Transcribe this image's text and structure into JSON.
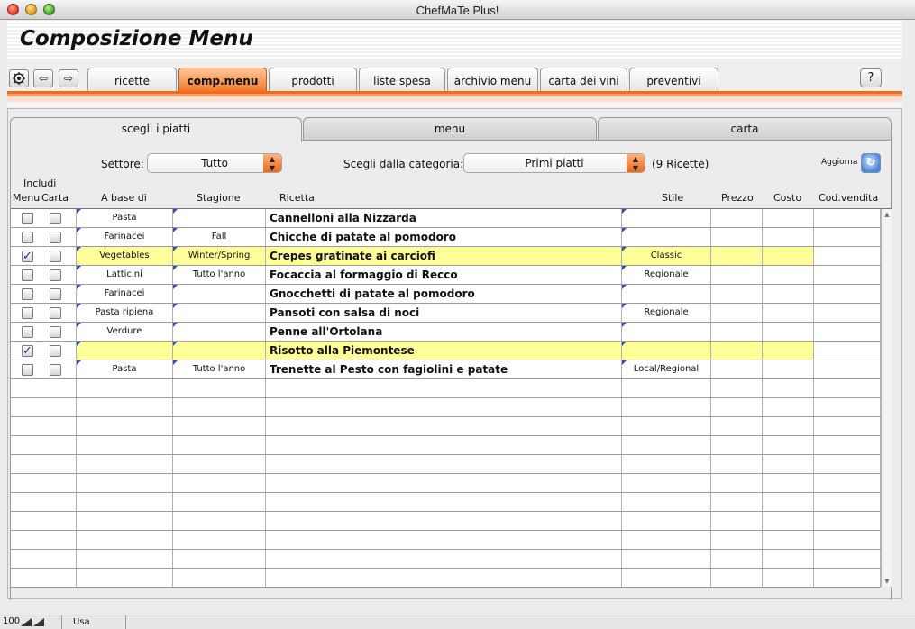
{
  "window": {
    "title": "ChefMaTe Plus!"
  },
  "page_title": "Composizione Menu",
  "toolbar": {
    "tabs": [
      "ricette",
      "comp.menu",
      "prodotti",
      "liste spesa",
      "archivio menu",
      "carta dei vini",
      "preventivi"
    ],
    "active_tab": "comp.menu",
    "help_label": "?"
  },
  "subtabs": [
    "scegli i piatti",
    "menu",
    "carta"
  ],
  "filters": {
    "settore_label": "Settore:",
    "settore_value": "Tutto",
    "categoria_label": "Scegli dalla categoria:",
    "categoria_value": "Primi piatti",
    "count_text": "(9 Ricette)",
    "aggiorna_label": "Aggiorna"
  },
  "columns": {
    "includi": "Includi",
    "menu": "Menu",
    "carta": "Carta",
    "a_base_di": "A base di",
    "stagione": "Stagione",
    "ricetta": "Ricetta",
    "stile": "Stile",
    "prezzo": "Prezzo",
    "costo": "Costo",
    "cod_vendita": "Cod.vendita"
  },
  "rows": [
    {
      "menu": false,
      "carta": false,
      "base": "Pasta",
      "stagione": "",
      "ricetta": "Cannelloni alla Nizzarda",
      "stile": "",
      "selected": false
    },
    {
      "menu": false,
      "carta": false,
      "base": "Farinacei",
      "stagione": "Fall",
      "ricetta": "Chicche di patate al pomodoro",
      "stile": "",
      "selected": false
    },
    {
      "menu": true,
      "carta": false,
      "base": "Vegetables",
      "stagione": "Winter/Spring",
      "ricetta": "Crepes gratinate ai carciofi",
      "stile": "Classic",
      "selected": true
    },
    {
      "menu": false,
      "carta": false,
      "base": "Latticini",
      "stagione": "Tutto l'anno",
      "ricetta": "Focaccia al formaggio di Recco",
      "stile": "Regionale",
      "selected": false
    },
    {
      "menu": false,
      "carta": false,
      "base": "Farinacei",
      "stagione": "",
      "ricetta": "Gnocchetti di patate al pomodoro",
      "stile": "",
      "selected": false
    },
    {
      "menu": false,
      "carta": false,
      "base": "Pasta ripiena",
      "stagione": "",
      "ricetta": "Pansoti con salsa di noci",
      "stile": "Regionale",
      "selected": false
    },
    {
      "menu": false,
      "carta": false,
      "base": "Verdure",
      "stagione": "",
      "ricetta": "Penne all'Ortolana",
      "stile": "",
      "selected": false
    },
    {
      "menu": true,
      "carta": false,
      "base": "",
      "stagione": "",
      "ricetta": "Risotto alla Piemontese",
      "stile": "",
      "selected": true
    },
    {
      "menu": false,
      "carta": false,
      "base": "Pasta",
      "stagione": "Tutto l'anno",
      "ricetta": "Trenette al Pesto con fagiolini e patate",
      "stile": "Local/Regional",
      "selected": false
    }
  ],
  "statusbar": {
    "zoom": "100",
    "language": "Usa"
  },
  "colors": {
    "accent_orange": "#f07a2c",
    "selected_row": "#ffff99"
  }
}
